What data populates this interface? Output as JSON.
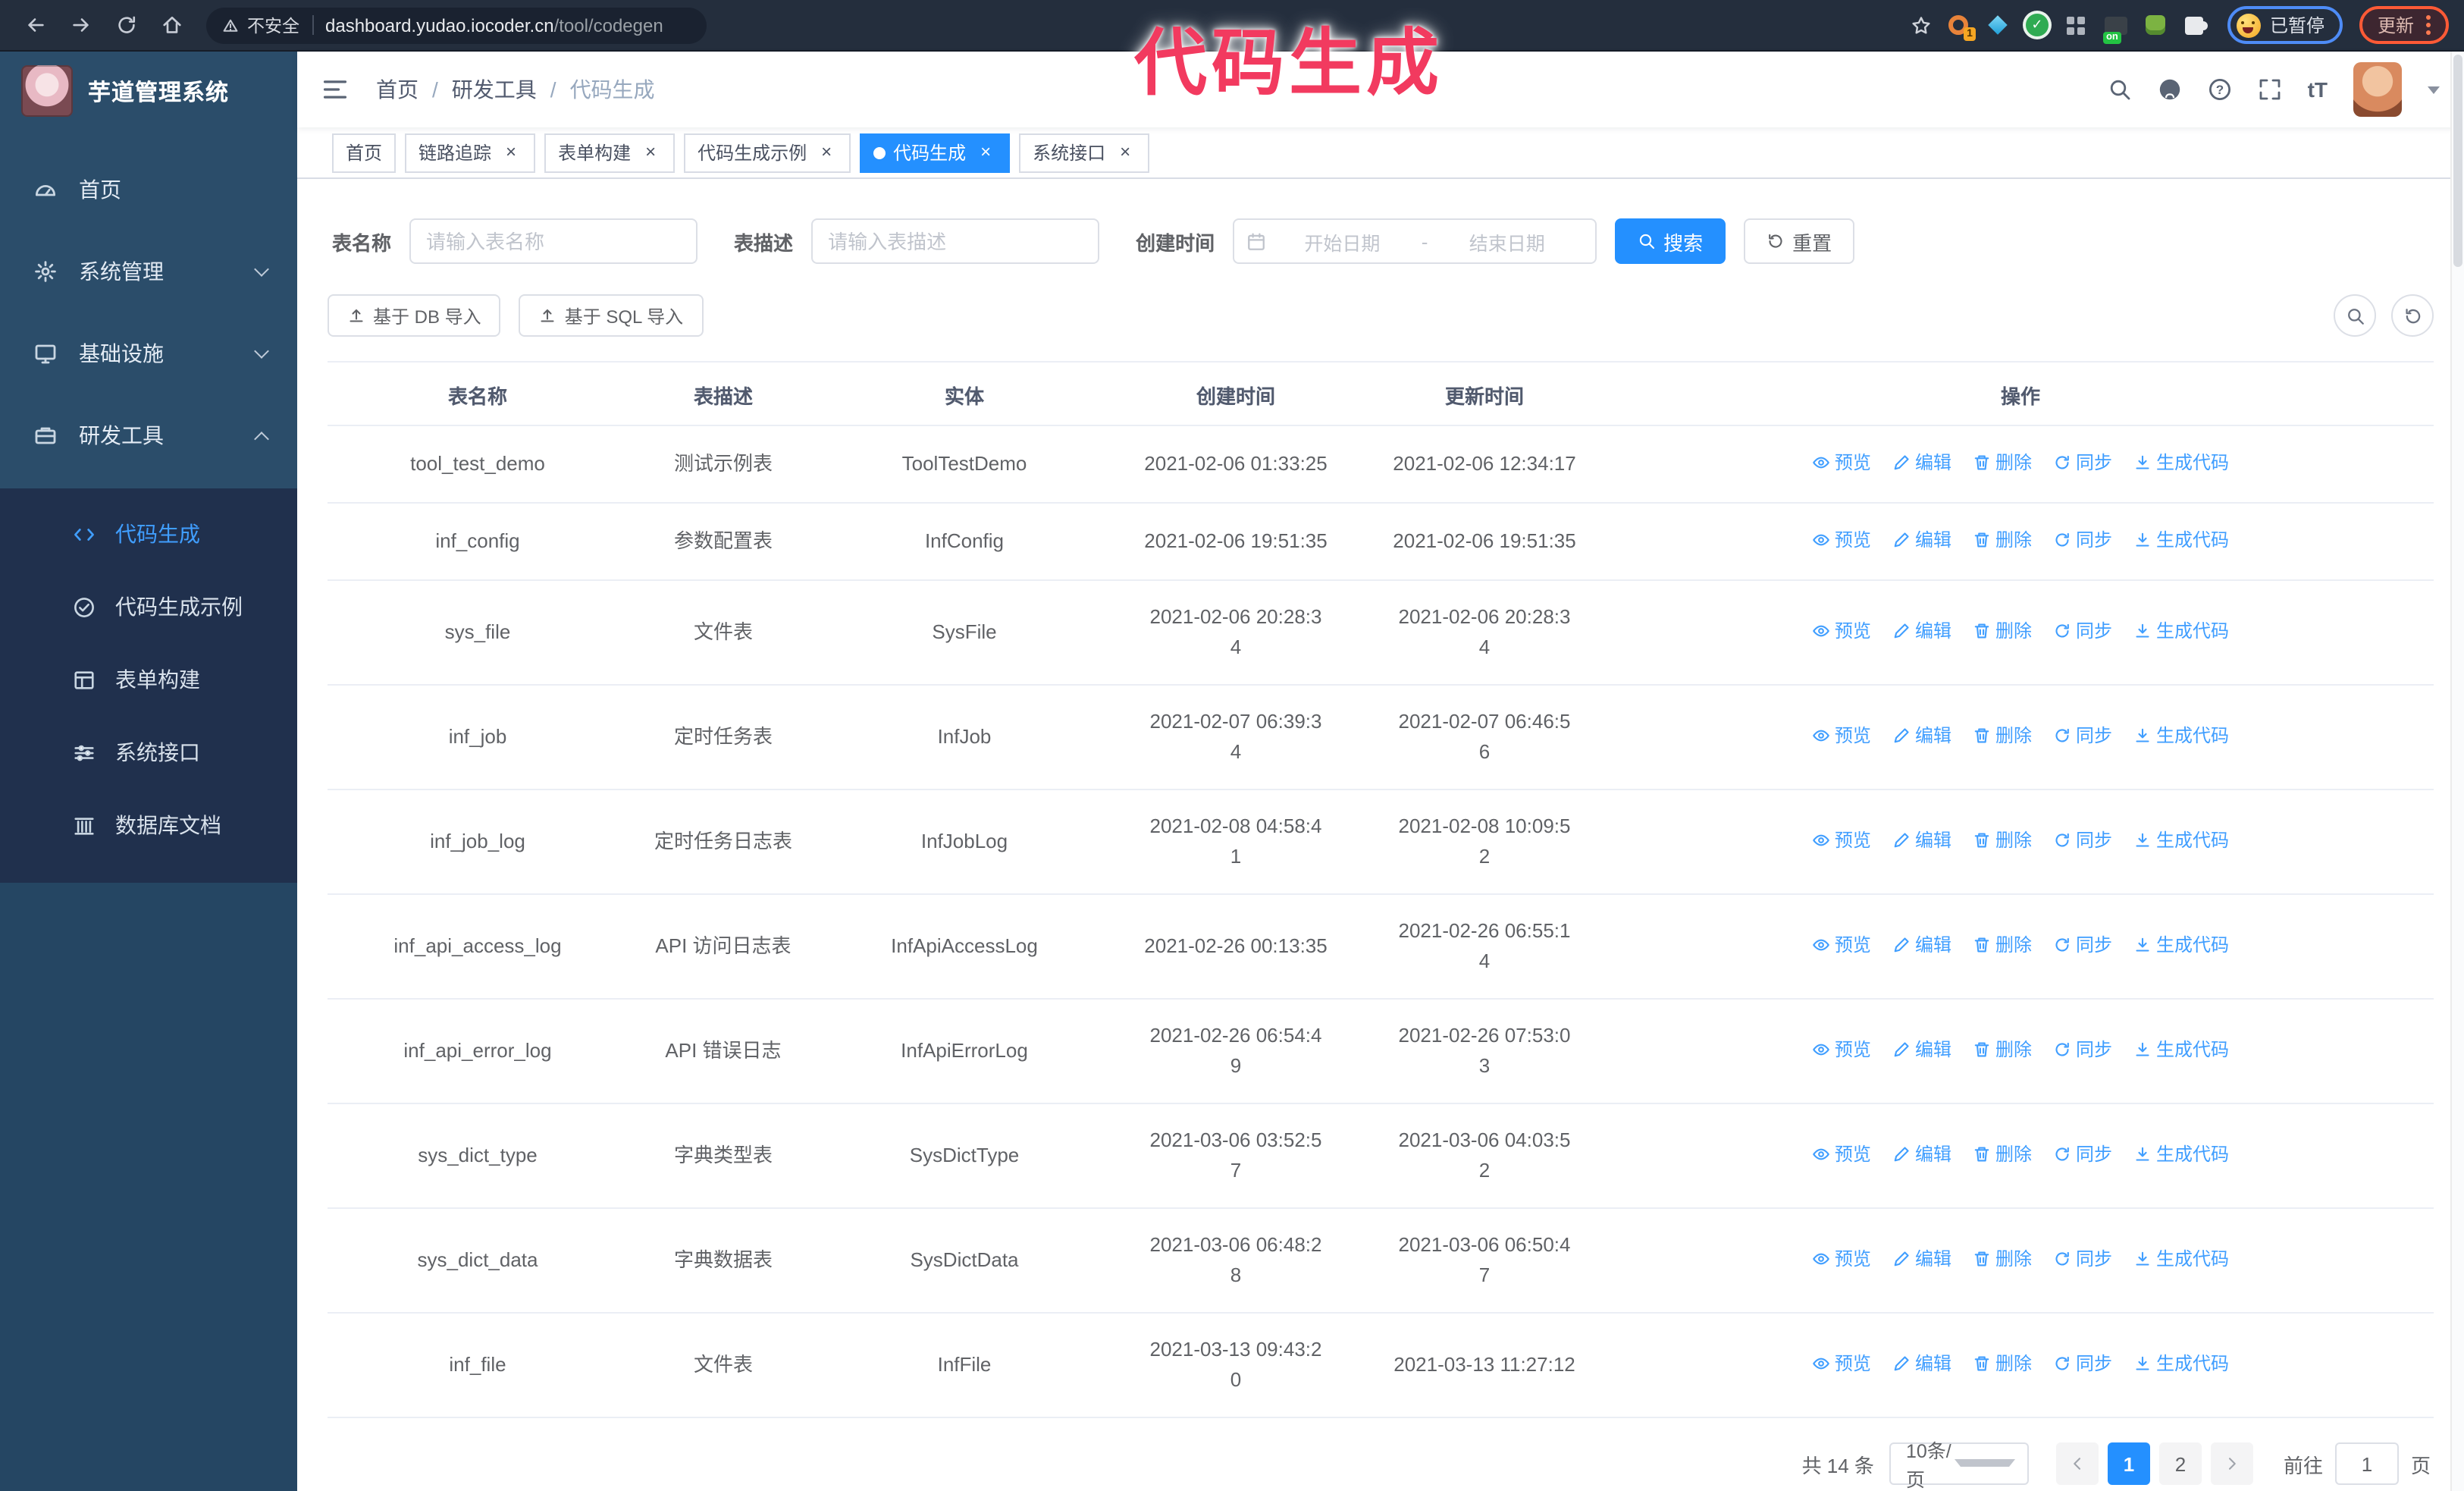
{
  "browser": {
    "security_label": "不安全",
    "url_host": "dashboard.yudao.iocoder.cn",
    "url_path": "/tool/codegen",
    "extension_badge": "1",
    "extension_on_badge": "on",
    "paused_badge": "已暂停",
    "update_label": "更新"
  },
  "annotation": {
    "text": "代码生成"
  },
  "sidebar": {
    "app_title": "芋道管理系统",
    "items": [
      {
        "id": "home",
        "label": "首页",
        "icon": "dashboard"
      },
      {
        "id": "system",
        "label": "系统管理",
        "icon": "gear",
        "chevron": "down"
      },
      {
        "id": "infra",
        "label": "基础设施",
        "icon": "monitor",
        "chevron": "down"
      },
      {
        "id": "devtools",
        "label": "研发工具",
        "icon": "toolbox",
        "chevron": "up",
        "expanded": true
      }
    ],
    "submenu": [
      {
        "id": "codegen",
        "label": "代码生成",
        "icon": "code",
        "active": true
      },
      {
        "id": "codegen-example",
        "label": "代码生成示例",
        "icon": "circle-check"
      },
      {
        "id": "form-builder",
        "label": "表单构建",
        "icon": "form"
      },
      {
        "id": "api",
        "label": "系统接口",
        "icon": "sliders"
      },
      {
        "id": "db-doc",
        "label": "数据库文档",
        "icon": "columns"
      }
    ]
  },
  "header": {
    "breadcrumb": [
      "首页",
      "研发工具",
      "代码生成"
    ],
    "font_icon_label": "tT"
  },
  "tabs": [
    {
      "id": "home",
      "label": "首页",
      "closable": false
    },
    {
      "id": "trace",
      "label": "链路追踪",
      "closable": true
    },
    {
      "id": "form-builder",
      "label": "表单构建",
      "closable": true
    },
    {
      "id": "codegen-example",
      "label": "代码生成示例",
      "closable": true
    },
    {
      "id": "codegen",
      "label": "代码生成",
      "closable": true,
      "active": true
    },
    {
      "id": "api",
      "label": "系统接口",
      "closable": true
    }
  ],
  "filters": {
    "name_label": "表名称",
    "name_placeholder": "请输入表名称",
    "desc_label": "表描述",
    "desc_placeholder": "请输入表描述",
    "date_label": "创建时间",
    "date_start": "开始日期",
    "date_separator": "-",
    "date_end": "结束日期",
    "search_label": "搜索",
    "reset_label": "重置"
  },
  "toolbar": {
    "import_db": "基于 DB 导入",
    "import_sql": "基于 SQL 导入"
  },
  "table": {
    "columns": [
      "表名称",
      "表描述",
      "实体",
      "创建时间",
      "更新时间",
      "操作"
    ],
    "action_labels": [
      "预览",
      "编辑",
      "删除",
      "同步",
      "生成代码"
    ],
    "rows": [
      {
        "name": "tool_test_demo",
        "desc": "测试示例表",
        "entity": "ToolTestDemo",
        "created": "2021-02-06 01:33:25",
        "updated": "2021-02-06 12:34:17"
      },
      {
        "name": "inf_config",
        "desc": "参数配置表",
        "entity": "InfConfig",
        "created": "2021-02-06 19:51:35",
        "updated": "2021-02-06 19:51:35"
      },
      {
        "name": "sys_file",
        "desc": "文件表",
        "entity": "SysFile",
        "created": "2021-02-06 20:28:3\n4",
        "updated": "2021-02-06 20:28:3\n4"
      },
      {
        "name": "inf_job",
        "desc": "定时任务表",
        "entity": "InfJob",
        "created": "2021-02-07 06:39:3\n4",
        "updated": "2021-02-07 06:46:5\n6"
      },
      {
        "name": "inf_job_log",
        "desc": "定时任务日志表",
        "entity": "InfJobLog",
        "created": "2021-02-08 04:58:4\n1",
        "updated": "2021-02-08 10:09:5\n2"
      },
      {
        "name": "inf_api_access_log",
        "desc": "API 访问日志表",
        "entity": "InfApiAccessLog",
        "created": "2021-02-26 00:13:35",
        "updated": "2021-02-26 06:55:1\n4"
      },
      {
        "name": "inf_api_error_log",
        "desc": "API 错误日志",
        "entity": "InfApiErrorLog",
        "created": "2021-02-26 06:54:4\n9",
        "updated": "2021-02-26 07:53:0\n3"
      },
      {
        "name": "sys_dict_type",
        "desc": "字典类型表",
        "entity": "SysDictType",
        "created": "2021-03-06 03:52:5\n7",
        "updated": "2021-03-06 04:03:5\n2"
      },
      {
        "name": "sys_dict_data",
        "desc": "字典数据表",
        "entity": "SysDictData",
        "created": "2021-03-06 06:48:2\n8",
        "updated": "2021-03-06 06:50:4\n7"
      },
      {
        "name": "inf_file",
        "desc": "文件表",
        "entity": "InfFile",
        "created": "2021-03-13 09:43:2\n0",
        "updated": "2021-03-13 11:27:12"
      }
    ]
  },
  "pagination": {
    "total": "共 14 条",
    "page_size": "10条/页",
    "pages": [
      "1",
      "2"
    ],
    "active_page": "1",
    "goto_label": "前往",
    "goto_value": "1",
    "page_unit": "页"
  },
  "colors": {
    "primary": "#2490ff",
    "link": "#409eff",
    "annotation": "#f23a5f"
  }
}
